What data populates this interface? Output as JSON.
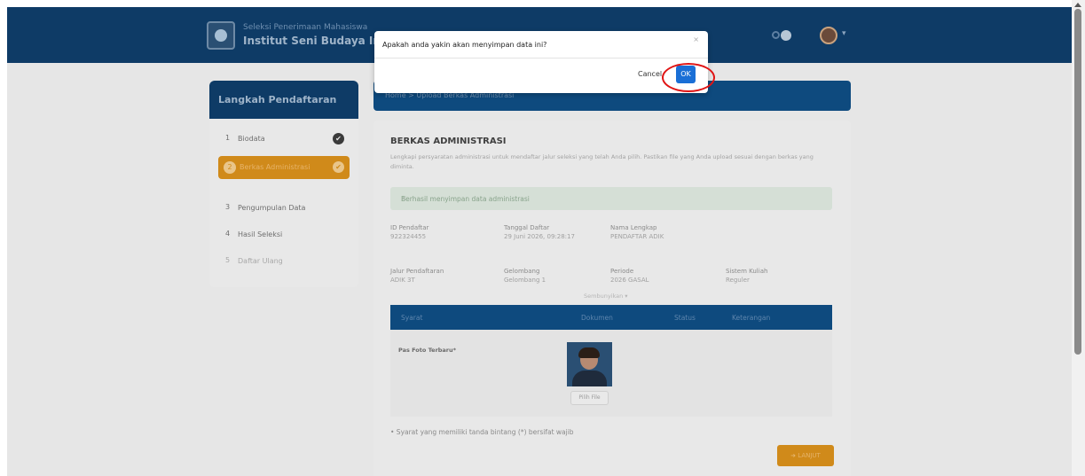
{
  "header": {
    "brand_small": "Seleksi Penerimaan Mahasiswa",
    "brand_big": "Institut Seni Budaya Indon"
  },
  "sidebar": {
    "title": "Langkah Pendaftaran",
    "steps": [
      {
        "num": "1",
        "label": "Biodata",
        "done": "✔"
      },
      {
        "num": "2",
        "label": "Berkas Administrasi",
        "done": "✔"
      },
      {
        "num": "3",
        "label": "Pengumpulan Data"
      },
      {
        "num": "4",
        "label": "Hasil Seleksi"
      },
      {
        "num": "5",
        "label": "Daftar Ulang"
      }
    ]
  },
  "breadcrumb": "Home  >  Upload Berkas Administrasi",
  "main": {
    "title": "BERKAS ADMINISTRASI",
    "description": "Lengkapi persyaratan administrasi untuk mendaftar jalur seleksi yang telah Anda pilih. Pastikan file yang Anda upload sesuai dengan berkas yang diminta.",
    "alert": "Berhasil menyimpan data administrasi",
    "alert_close": "×",
    "fields": {
      "id_label": "ID Pendaftar",
      "id_value": "922324455",
      "tanggal_label": "Tanggal Daftar",
      "tanggal_value": "29 Juni 2026, 09:28:17",
      "nama_label": "Nama Lengkap",
      "nama_value": "PENDAFTAR ADIK",
      "jalur_label": "Jalur Pendaftaran",
      "jalur_value": "ADIK 3T",
      "gelombang_label": "Gelombang",
      "gelombang_value": "Gelombang 1",
      "periode_label": "Periode",
      "periode_value": "2026 GASAL",
      "sistem_label": "Sistem Kuliah",
      "sistem_value": "Reguler"
    },
    "more_toggle": "Sembunyikan ▾",
    "table": {
      "headers": [
        "Syarat",
        "Dokumen",
        "Status",
        "Keterangan"
      ],
      "rows": [
        {
          "syarat": "Pas Foto Terbaru*",
          "button": "Pilih File"
        }
      ]
    },
    "note": "•  Syarat yang memiliki tanda bintang (*) bersifat wajib",
    "next_button": "➜ LANJUT"
  },
  "dialog": {
    "message": "Apakah anda yakin akan menyimpan data ini?",
    "close": "×",
    "cancel": "Cancel",
    "ok": "OK"
  }
}
